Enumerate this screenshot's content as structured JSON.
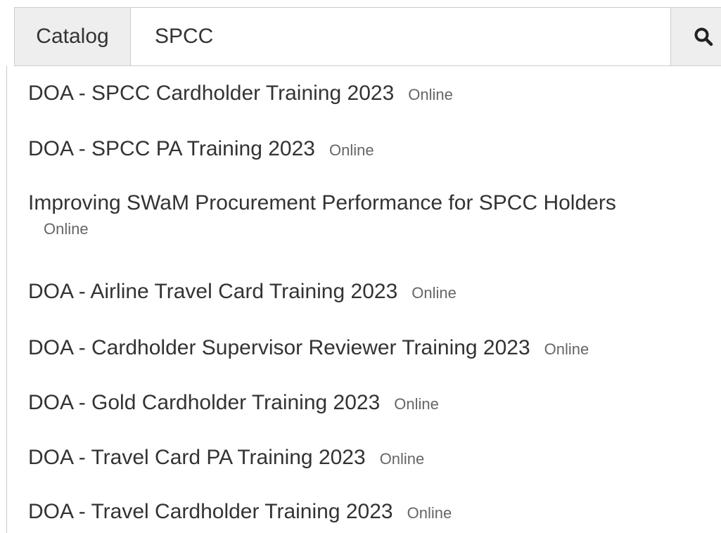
{
  "search": {
    "scope_label": "Catalog",
    "query": "SPCC",
    "search_icon": "search-icon"
  },
  "results": [
    {
      "title": "DOA - SPCC Cardholder Training 2023",
      "format": "Online"
    },
    {
      "title": "DOA - SPCC PA Training 2023",
      "format": "Online"
    },
    {
      "title": "Improving SWaM Procurement Performance for SPCC Holders",
      "format": "Online"
    },
    {
      "title": "DOA - Airline Travel Card Training 2023",
      "format": "Online"
    },
    {
      "title": "DOA - Cardholder Supervisor Reviewer Training 2023",
      "format": "Online"
    },
    {
      "title": "DOA - Gold Cardholder Training 2023",
      "format": "Online"
    },
    {
      "title": "DOA - Travel Card PA Training 2023",
      "format": "Online"
    },
    {
      "title": "DOA - Travel Cardholder Training 2023",
      "format": "Online"
    }
  ]
}
